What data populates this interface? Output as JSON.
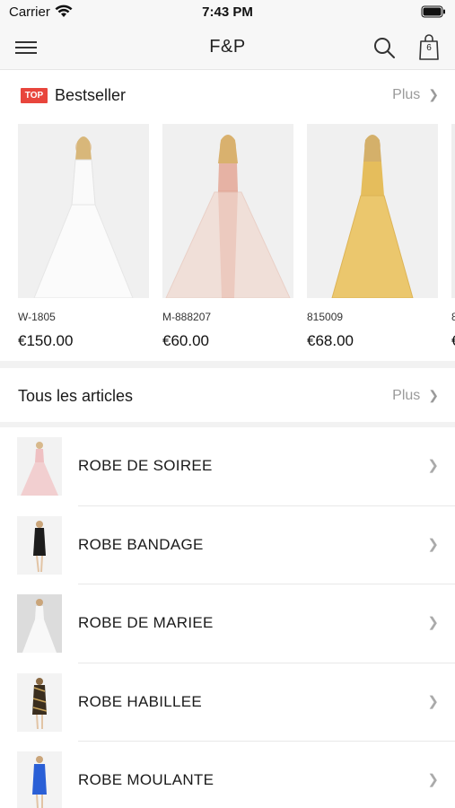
{
  "status_bar": {
    "carrier": "Carrier",
    "time": "7:43 PM"
  },
  "nav": {
    "title": "F&P",
    "bag_count": "6"
  },
  "bestseller": {
    "badge": "TOP",
    "title": "Bestseller",
    "more": "Plus",
    "products": [
      {
        "sku": "W-1805",
        "price": "€150.00",
        "dress_color": "#f4f4f2"
      },
      {
        "sku": "M-888207",
        "price": "€60.00",
        "dress_color": "#e8b7a8"
      },
      {
        "sku": "815009",
        "price": "€68.00",
        "dress_color": "#e9c46a"
      },
      {
        "sku": "8",
        "price": "€"
      }
    ]
  },
  "articles": {
    "title": "Tous les articles",
    "more": "Plus",
    "categories": [
      {
        "label": "ROBE DE SOIREE",
        "dress_color": "#efc0c2"
      },
      {
        "label": "ROBE BANDAGE",
        "dress_color": "#1c1c1c"
      },
      {
        "label": "ROBE DE MARIEE",
        "dress_color": "#f5f5f5"
      },
      {
        "label": "ROBE HABILLEE",
        "dress_color": "#3a2e1f"
      },
      {
        "label": "ROBE MOULANTE",
        "dress_color": "#2a5fd6"
      }
    ]
  },
  "colors": {
    "accent": "#e8453c",
    "muted": "#9a9a9a"
  }
}
